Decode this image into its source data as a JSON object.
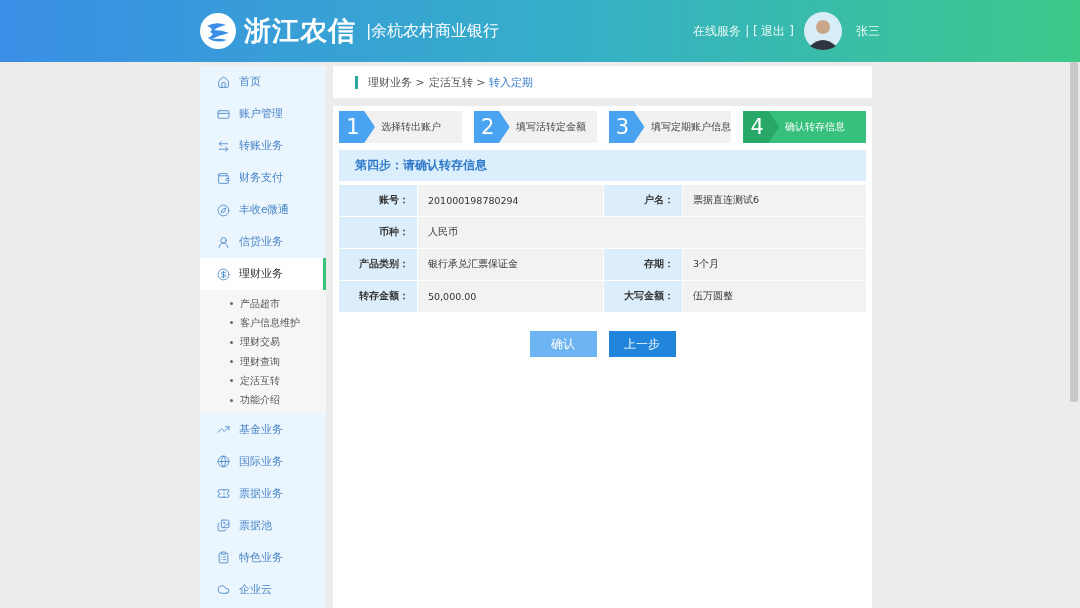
{
  "header": {
    "brand": "浙江农信",
    "bank": "|余杭农村商业银行",
    "links": [
      {
        "label": "在线服务"
      },
      {
        "label": "| [ 退出 ]"
      }
    ],
    "user": "张三"
  },
  "sidebar": {
    "items": [
      {
        "label": "首页",
        "selected": false
      },
      {
        "label": "账户管理",
        "selected": false
      },
      {
        "label": "转账业务",
        "selected": false
      },
      {
        "label": "财务支付",
        "selected": false
      },
      {
        "label": "丰收e微通",
        "selected": false
      },
      {
        "label": "信贷业务",
        "selected": false
      },
      {
        "label": "理财业务",
        "selected": true,
        "expanded": true,
        "children": [
          {
            "label": "产品超市"
          },
          {
            "label": "客户信息维护"
          },
          {
            "label": "理财交易"
          },
          {
            "label": "理财查询"
          },
          {
            "label": "定活互转"
          },
          {
            "label": "功能介绍"
          }
        ]
      },
      {
        "label": "基金业务",
        "selected": false
      },
      {
        "label": "国际业务",
        "selected": false
      },
      {
        "label": "票据业务",
        "selected": false
      },
      {
        "label": "票据池",
        "selected": false
      },
      {
        "label": "特色业务",
        "selected": false
      },
      {
        "label": "企业云",
        "selected": false
      }
    ]
  },
  "breadcrumb": [
    {
      "label": "理财业务 >",
      "current": false
    },
    {
      "label": "定活互转 >",
      "current": false
    },
    {
      "label": "转入定期",
      "current": true
    }
  ],
  "steps": [
    {
      "number": "1",
      "label": "选择转出账户",
      "selected": false
    },
    {
      "number": "2",
      "label": "填写活转定金额",
      "selected": false
    },
    {
      "number": "3",
      "label": "填写定期账户信息",
      "selected": false
    },
    {
      "number": "4",
      "label": "确认转存信息",
      "selected": true
    }
  ],
  "section_title": "第四步：请确认转存信息",
  "details": [
    [
      {
        "label": "账号：",
        "value": "201000198780294"
      },
      {
        "label": "户名：",
        "value": "票据直连测试6"
      }
    ],
    [
      {
        "label": "币种：",
        "value": "人民币"
      }
    ],
    [
      {
        "label": "产品类别：",
        "value": "银行承兑汇票保证金"
      },
      {
        "label": "存期：",
        "value": "3个月"
      }
    ],
    [
      {
        "label": "转存金额：",
        "value": "50,000.00"
      },
      {
        "label": "大写金额：",
        "value": "伍万圆整"
      }
    ]
  ],
  "buttons": [
    {
      "label": "确认",
      "disabled": true
    },
    {
      "label": "上一步",
      "disabled": false
    }
  ]
}
